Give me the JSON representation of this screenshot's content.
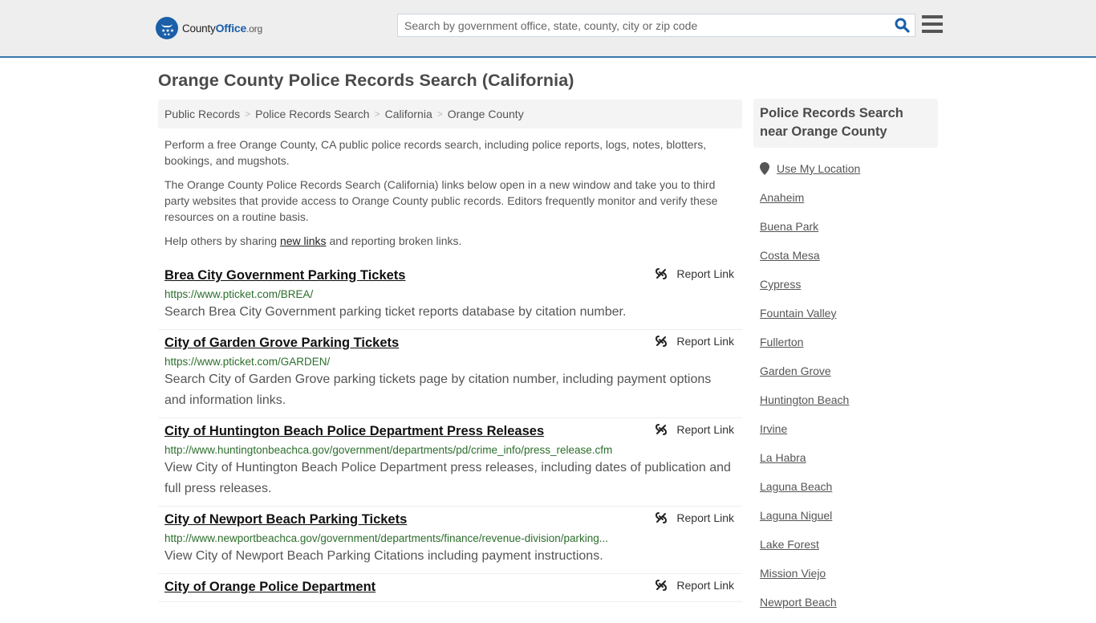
{
  "header": {
    "logo": {
      "county": "County",
      "office": "Office",
      "tld": ".org"
    },
    "search_placeholder": "Search by government office, state, county, city or zip code",
    "colors": {
      "brand": "#1a5fa8",
      "border_accent": "#3a78ac",
      "url_green": "#2c6e2c"
    }
  },
  "page_title": "Orange County Police Records Search (California)",
  "breadcrumb": [
    "Public Records",
    "Police Records Search",
    "California",
    "Orange County"
  ],
  "intro": {
    "p1": "Perform a free Orange County, CA public police records search, including police reports, logs, notes, blotters, bookings, and mugshots.",
    "p2": "The Orange County Police Records Search (California) links below open in a new window and take you to third party websites that provide access to Orange County public records. Editors frequently monitor and verify these resources on a routine basis.",
    "p3_before": "Help others by sharing ",
    "p3_link": "new links",
    "p3_after": " and reporting broken links."
  },
  "report_label": "Report Link",
  "results": [
    {
      "title": "Brea City Government Parking Tickets",
      "url": "https://www.pticket.com/BREA/",
      "desc": "Search Brea City Government parking ticket reports database by citation number."
    },
    {
      "title": "City of Garden Grove Parking Tickets",
      "url": "https://www.pticket.com/GARDEN/",
      "desc": "Search City of Garden Grove parking tickets page by citation number, including payment options and information links."
    },
    {
      "title": "City of Huntington Beach Police Department Press Releases",
      "url": "http://www.huntingtonbeachca.gov/government/departments/pd/crime_info/press_release.cfm",
      "desc": "View City of Huntington Beach Police Department press releases, including dates of publication and full press releases."
    },
    {
      "title": "City of Newport Beach Parking Tickets",
      "url": "http://www.newportbeachca.gov/government/departments/finance/revenue-division/parking...",
      "desc": "View City of Newport Beach Parking Citations including payment instructions."
    },
    {
      "title": "City of Orange Police Department",
      "url": "",
      "desc": ""
    }
  ],
  "sidebar": {
    "heading": "Police Records Search near Orange County",
    "use_location": "Use My Location",
    "cities": [
      "Anaheim",
      "Buena Park",
      "Costa Mesa",
      "Cypress",
      "Fountain Valley",
      "Fullerton",
      "Garden Grove",
      "Huntington Beach",
      "Irvine",
      "La Habra",
      "Laguna Beach",
      "Laguna Niguel",
      "Lake Forest",
      "Mission Viejo",
      "Newport Beach"
    ]
  }
}
